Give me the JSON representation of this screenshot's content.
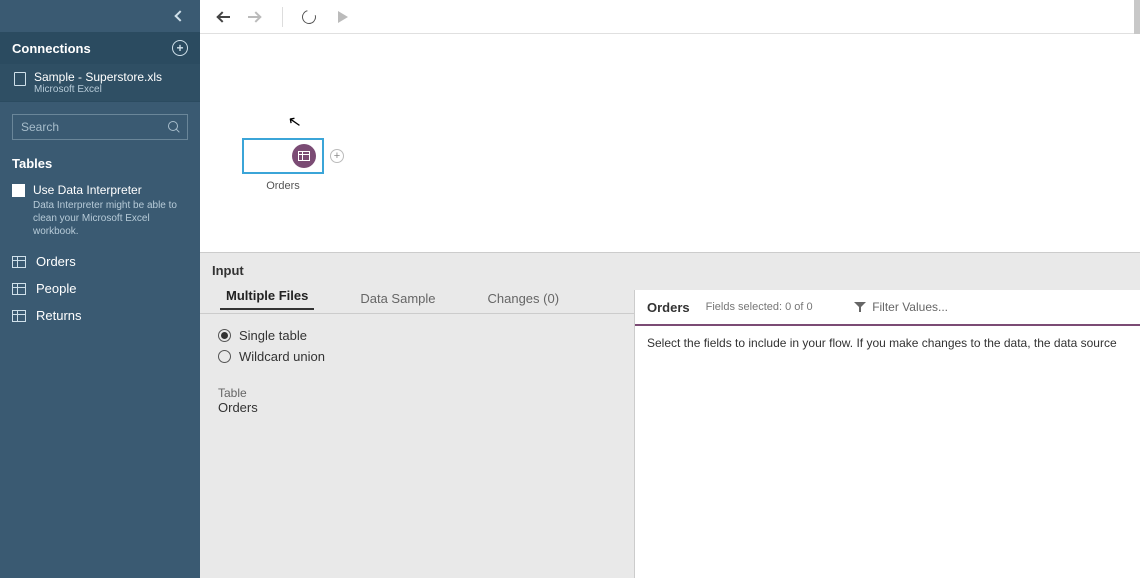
{
  "sidebar": {
    "connections_label": "Connections",
    "connection": {
      "name": "Sample - Superstore.xls",
      "type": "Microsoft Excel"
    },
    "search_placeholder": "Search",
    "tables_label": "Tables",
    "interpreter": {
      "title": "Use Data Interpreter",
      "desc": "Data Interpreter might be able to clean your Microsoft Excel workbook."
    },
    "tables": [
      "Orders",
      "People",
      "Returns"
    ]
  },
  "canvas": {
    "node_label": "Orders"
  },
  "bottom": {
    "section_label": "Input",
    "tabs": {
      "multiple_files": "Multiple Files",
      "data_sample": "Data Sample",
      "changes": "Changes (0)"
    },
    "radios": {
      "single_table": "Single table",
      "wildcard_union": "Wildcard union"
    },
    "table_heading": "Table",
    "table_value": "Orders",
    "right": {
      "title": "Orders",
      "fields_selected": "Fields selected: 0 of 0",
      "filter_label": "Filter Values...",
      "message": "Select the fields to include in your flow. If you make changes to the data, the data source"
    }
  }
}
